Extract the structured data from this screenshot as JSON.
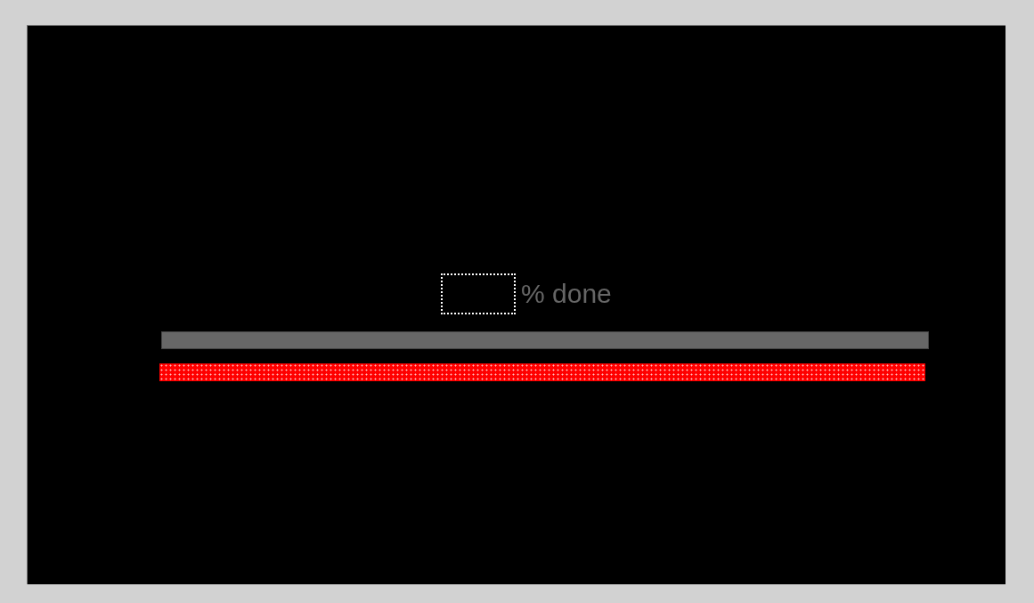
{
  "percent_field": {
    "focused": true
  },
  "label": "% done"
}
